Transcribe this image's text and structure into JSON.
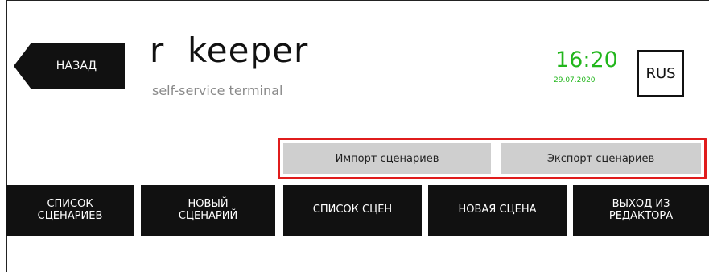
{
  "header": {
    "back_label": "НАЗАД",
    "brand": "r  keeper",
    "tagline": "self-service terminal",
    "time": "16:20",
    "date": "29.07.2020",
    "language": "RUS"
  },
  "scenario_io": {
    "import_label": "Импорт сценариев",
    "export_label": "Экспорт сценариев"
  },
  "nav": {
    "items": [
      {
        "label": "СПИСОК\nСЦЕНАРИЕВ"
      },
      {
        "label": "НОВЫЙ\nСЦЕНАРИЙ"
      },
      {
        "label": "СПИСОК СЦЕН"
      },
      {
        "label": "НОВАЯ СЦЕНА"
      },
      {
        "label": "ВЫХОД ИЗ\nРЕДАКТОРА"
      }
    ]
  },
  "colors": {
    "accent_green": "#22b61c",
    "highlight_red": "#e01c1c",
    "button_dark": "#111111",
    "button_gray": "#cfcfcf"
  }
}
